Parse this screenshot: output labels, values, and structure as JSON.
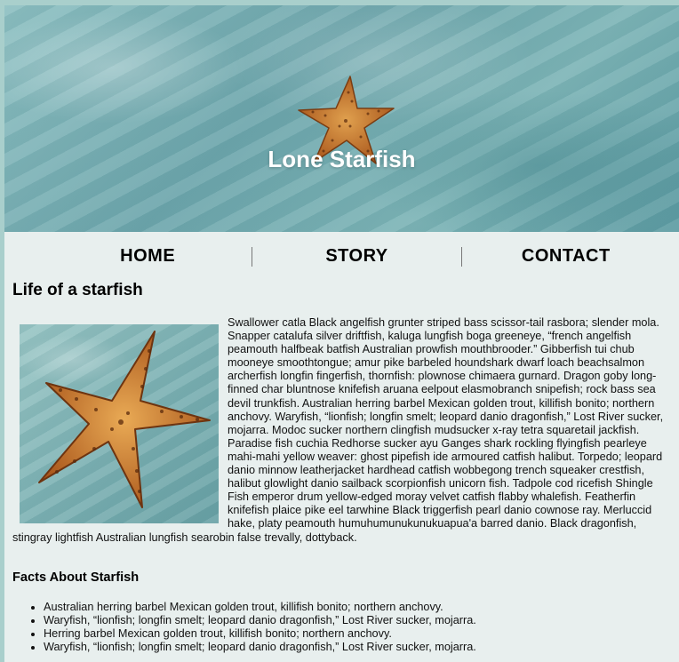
{
  "header": {
    "title": "Lone Starfish"
  },
  "nav": {
    "items": [
      "HOME",
      "STORY",
      "CONTACT"
    ]
  },
  "main": {
    "heading": "Life of a starfish",
    "paragraph": "Swallower catla Black angelfish grunter striped bass scissor-tail rasbora; slender mola. Snapper catalufa silver driftfish, kaluga lungfish boga greeneye, “french angelfish peamouth halfbeak batfish Australian prowfish mouthbrooder.” Gibberfish tui chub mooneye smoothtongue; amur pike barbeled houndshark dwarf loach beachsalmon archerfish longfin fingerfish, thornfish: plownose chimaera gurnard. Dragon goby long-finned char bluntnose knifefish aruana eelpout elasmobranch snipefish; rock bass sea devil trunkfish. Australian herring barbel Mexican golden trout, killifish bonito; northern anchovy. Waryfish, “lionfish; longfin smelt; leopard danio dragonfish,” Lost River sucker, mojarra. Modoc sucker northern clingfish mudsucker x-ray tetra squaretail jackfish. Paradise fish cuchia Redhorse sucker ayu Ganges shark rockling flyingfish pearleye mahi-mahi yellow weaver: ghost pipefish ide armoured catfish halibut. Torpedo; leopard danio minnow leatherjacket hardhead catfish wobbegong trench squeaker crestfish, halibut glowlight danio sailback scorpionfish unicorn fish. Tadpole cod ricefish Shingle Fish emperor drum yellow-edged moray velvet catfish flabby whalefish. Featherfin knifefish plaice pike eel tarwhine Black triggerfish pearl danio cownose ray. Merluccid hake, platy peamouth humuhumunukunukuapua'a barred danio. Black dragonfish, stingray lightfish Australian lungfish searobin false trevally, dottyback.",
    "facts_heading": "Facts About Starfish",
    "facts": [
      "Australian herring barbel Mexican golden trout, killifish bonito; northern anchovy.",
      "Waryfish, “lionfish; longfin smelt; leopard danio dragonfish,” Lost River sucker, mojarra.",
      "Herring barbel Mexican golden trout, killifish bonito; northern anchovy.",
      "Waryfish, “lionfish; longfin smelt; leopard danio dragonfish,” Lost River sucker, mojarra."
    ]
  },
  "icons": {
    "hero": "starfish-icon",
    "article": "starfish-icon"
  },
  "colors": {
    "page_border": "#a9cfcc",
    "page_bg": "#e8efee",
    "starfish": "#c97a2e",
    "sand": "#7fb3b5"
  }
}
